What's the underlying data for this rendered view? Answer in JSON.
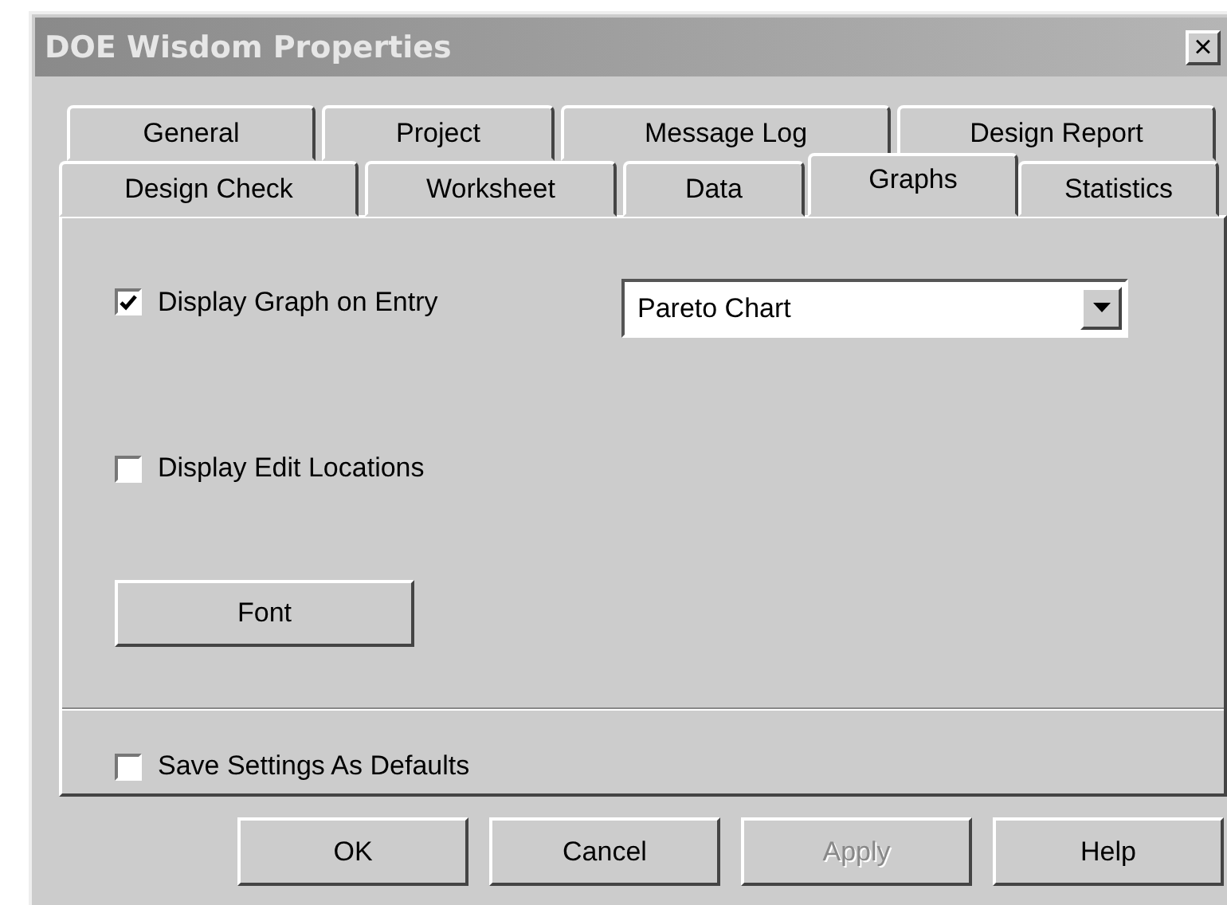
{
  "window": {
    "title": "DOE Wisdom Properties",
    "close": "×"
  },
  "tab_rows": [
    [
      {
        "label": "General",
        "selected": false
      },
      {
        "label": "Project",
        "selected": false
      },
      {
        "label": "Message Log",
        "selected": false
      },
      {
        "label": "Design Report",
        "selected": false
      }
    ],
    [
      {
        "label": "Design Check",
        "selected": false
      },
      {
        "label": "Worksheet",
        "selected": false
      },
      {
        "label": "Data",
        "selected": false
      },
      {
        "label": "Graphs",
        "selected": true
      },
      {
        "label": "Statistics",
        "selected": false
      }
    ]
  ],
  "display_graph_on_entry": {
    "label": "Display Graph on Entry",
    "checked": true
  },
  "graph_type": {
    "value": "Pareto Chart"
  },
  "display_edit_locations": {
    "label": "Display Edit Locations",
    "checked": false
  },
  "font_button": "Font",
  "save_defaults": {
    "label": "Save Settings As Defaults",
    "checked": false
  },
  "buttons": [
    {
      "label": "OK",
      "disabled": false
    },
    {
      "label": "Cancel",
      "disabled": false
    },
    {
      "label": "Apply",
      "disabled": true
    },
    {
      "label": "Help",
      "disabled": false
    }
  ]
}
